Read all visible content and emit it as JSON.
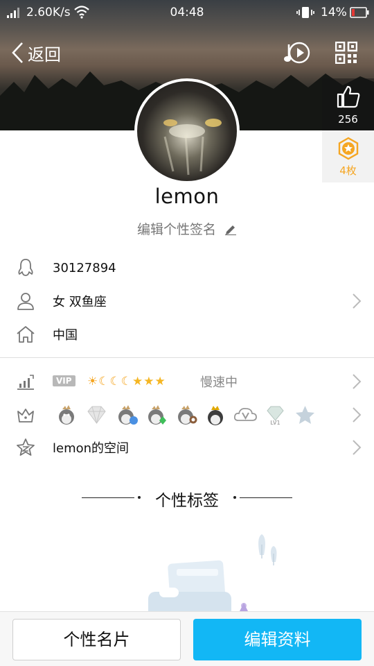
{
  "status_bar": {
    "net_speed": "2.60K/s",
    "time": "04:48",
    "battery": "14%",
    "icons": [
      "signal-icon",
      "wifi-icon",
      "vibrate-icon",
      "battery-low-icon"
    ]
  },
  "nav": {
    "back_label": "返回",
    "icons": [
      "chevron-left-icon",
      "music-play-icon",
      "qr-code-icon"
    ]
  },
  "likes": {
    "count": "256",
    "icon": "thumbs-up-icon"
  },
  "medals": {
    "count": "4枚",
    "icon": "medal-star-icon"
  },
  "profile": {
    "nickname": "lemon",
    "signature_placeholder": "编辑个性签名"
  },
  "info": {
    "qq_number": "30127894",
    "gender_constellation": "女  双鱼座",
    "location": "中国"
  },
  "vip": {
    "badge": "VIP",
    "level_icons": [
      "sun",
      "moon",
      "moon",
      "moon",
      "star",
      "star",
      "star"
    ],
    "speed_status": "慢速中"
  },
  "privileges": {
    "icons": [
      "qq-penguin-crown-icon",
      "diamond-icon",
      "penguin-blue-icon",
      "penguin-green-icon",
      "penguin-cat-icon",
      "penguin-gold-crown-icon",
      "cloud-v-icon",
      "diamond-lv1-icon",
      "star-badge-icon"
    ]
  },
  "space": {
    "label": "lemon的空间"
  },
  "tags": {
    "title": "个性标签"
  },
  "bottom": {
    "card_label": "个性名片",
    "edit_label": "编辑资料"
  },
  "colors": {
    "accent": "#12b7f5",
    "medal": "#f5a623",
    "text_secondary": "#888888"
  }
}
